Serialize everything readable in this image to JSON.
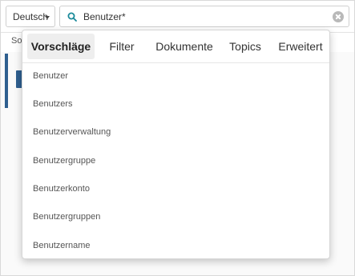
{
  "language_select": {
    "value": "Deutsch"
  },
  "search": {
    "value": "Benutzer*"
  },
  "subbar": {
    "label": "So"
  },
  "dropdown": {
    "tabs": [
      {
        "label": "Vorschläge",
        "active": true
      },
      {
        "label": "Filter",
        "active": false
      },
      {
        "label": "Dokumente",
        "active": false
      },
      {
        "label": "Topics",
        "active": false
      },
      {
        "label": "Erweitert",
        "active": false
      }
    ],
    "suggestions": [
      "Benutzer",
      "Benutzers",
      "Benutzerverwaltung",
      "Benutzergruppe",
      "Benutzerkonto",
      "Benutzergruppen",
      "Benutzername"
    ]
  },
  "colors": {
    "accent": "#2f5f8f",
    "search_icon": "#1a8a9a",
    "active_tab_bg": "#eeeeee"
  },
  "icons": {
    "search": "search-icon",
    "clear": "clear-icon",
    "caret": "chevron-down-icon"
  }
}
